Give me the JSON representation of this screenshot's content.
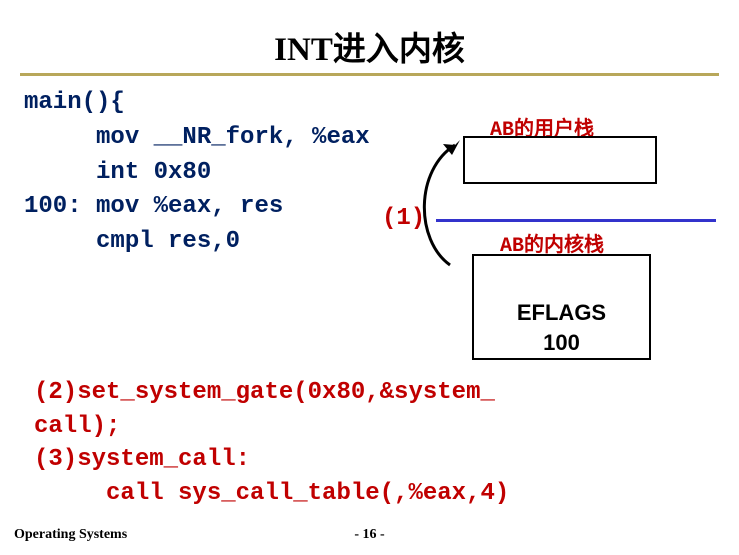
{
  "title": "INT进入内核",
  "code": {
    "l1": "main(){",
    "l2": "     mov __NR_fork, %eax",
    "l3": "     int 0x80",
    "l4": "100: mov %eax, res",
    "l5": "     cmpl res,0"
  },
  "marker1": "(1)",
  "stacks": {
    "user_label": "AB的用户栈",
    "kernel_label": "AB的内核栈",
    "eflags": "EFLAGS",
    "val100": "100"
  },
  "code_red": {
    "l1": "(2)set_system_gate(0x80,&system_",
    "l2": "call);",
    "l3": "(3)system_call:",
    "l4": "     call sys_call_table(,%eax,4)"
  },
  "footer": {
    "left": "Operating Systems",
    "center": "- 16 -"
  }
}
